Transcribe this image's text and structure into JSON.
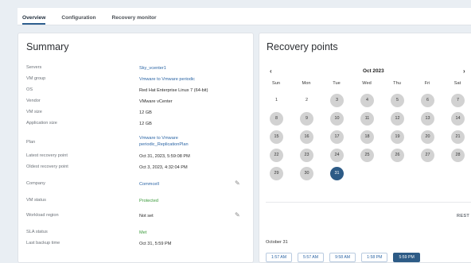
{
  "tabs": [
    "Overview",
    "Configuration",
    "Recovery monitor"
  ],
  "summary": {
    "title": "Summary",
    "rows": [
      {
        "label": "Servers",
        "value": "Sky_vcenter1"
      },
      {
        "label": "VM group",
        "value": "Vmware to Vmware periodic"
      },
      {
        "label": "OS",
        "value": "Red Hat Enterprise Linux 7 (64-bit)"
      },
      {
        "label": "Vendor",
        "value": "VMware vCenter"
      },
      {
        "label": "VM size",
        "value": "12 GB"
      },
      {
        "label": "Application size",
        "value": "12 GB"
      },
      {
        "label": "Plan",
        "value": "Vmware to Vmware",
        "value2": "periodic_ReplicationPlan"
      },
      {
        "label": "Latest recovery point",
        "value": "Oct 31, 2023, 5:59:08 PM"
      },
      {
        "label": "Oldest recovery point",
        "value": "Oct 3, 2023, 4:32:04 PM"
      },
      {
        "label": "Company",
        "value": "Commcell"
      },
      {
        "label": "VM status",
        "value": "Protected"
      },
      {
        "label": "Workload region",
        "value": "Not set"
      },
      {
        "label": "SLA status",
        "value": "Met"
      },
      {
        "label": "Last backup time",
        "value": "Oct 31, 5:59 PM"
      }
    ]
  },
  "recovery": {
    "title": "Recovery points",
    "month": "Oct 2023",
    "prev_icon": "chevron-left-icon",
    "next_icon": "chevron-right-icon",
    "weekdays": [
      "Sun",
      "Mon",
      "Tue",
      "Wed",
      "Thu",
      "Fri",
      "Sat"
    ],
    "days": [
      "1",
      "2",
      "3",
      "4",
      "5",
      "6",
      "7",
      "8",
      "9",
      "10",
      "11",
      "12",
      "13",
      "14",
      "15",
      "16",
      "17",
      "18",
      "19",
      "20",
      "21",
      "22",
      "23",
      "24",
      "25",
      "26",
      "27",
      "28",
      "29",
      "30",
      "31"
    ],
    "restore_label": "REST",
    "selected_date": "October 31",
    "times": [
      "1:57 AM",
      "5:57 AM",
      "9:58 AM",
      "1:58 PM",
      "5:59 PM"
    ]
  },
  "colors": {
    "accent": "#2d5b86",
    "link": "#2b65a5",
    "success": "#3a9a3a",
    "marked_day": "#d2d2d2"
  },
  "icons": {
    "edit": "pencil-icon"
  }
}
